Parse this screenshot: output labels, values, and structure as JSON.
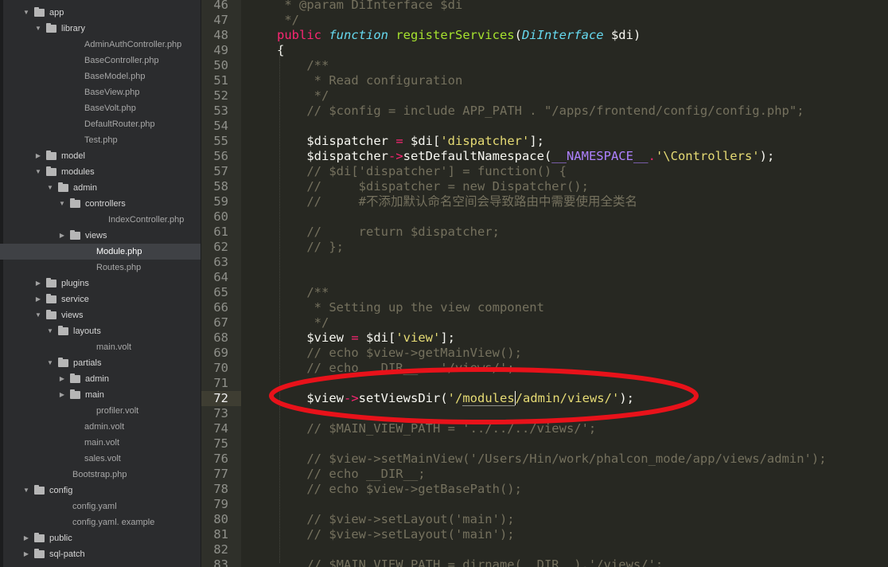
{
  "sidebar": {
    "items": [
      {
        "label": "app",
        "type": "folder",
        "open": true,
        "depth": 1
      },
      {
        "label": "library",
        "type": "folder",
        "open": true,
        "depth": 2
      },
      {
        "label": "AdminAuthController.php",
        "type": "file",
        "depth": 3
      },
      {
        "label": "BaseController.php",
        "type": "file",
        "depth": 3
      },
      {
        "label": "BaseModel.php",
        "type": "file",
        "depth": 3
      },
      {
        "label": "BaseView.php",
        "type": "file",
        "depth": 3
      },
      {
        "label": "BaseVolt.php",
        "type": "file",
        "depth": 3
      },
      {
        "label": "DefaultRouter.php",
        "type": "file",
        "depth": 3
      },
      {
        "label": "Test.php",
        "type": "file",
        "depth": 3
      },
      {
        "label": "model",
        "type": "folder",
        "open": false,
        "depth": 2
      },
      {
        "label": "modules",
        "type": "folder",
        "open": true,
        "depth": 2
      },
      {
        "label": "admin",
        "type": "folder",
        "open": true,
        "depth": 3
      },
      {
        "label": "controllers",
        "type": "folder",
        "open": true,
        "depth": 4
      },
      {
        "label": "IndexController.php",
        "type": "file",
        "depth": 5
      },
      {
        "label": "views",
        "type": "folder",
        "open": false,
        "depth": 4
      },
      {
        "label": "Module.php",
        "type": "file",
        "depth": 4,
        "selected": true
      },
      {
        "label": "Routes.php",
        "type": "file",
        "depth": 4
      },
      {
        "label": "plugins",
        "type": "folder",
        "open": false,
        "depth": 2
      },
      {
        "label": "service",
        "type": "folder",
        "open": false,
        "depth": 2
      },
      {
        "label": "views",
        "type": "folder",
        "open": true,
        "depth": 2
      },
      {
        "label": "layouts",
        "type": "folder",
        "open": true,
        "depth": 3
      },
      {
        "label": "main.volt",
        "type": "file",
        "depth": 4
      },
      {
        "label": "partials",
        "type": "folder",
        "open": true,
        "depth": 3
      },
      {
        "label": "admin",
        "type": "folder",
        "open": false,
        "depth": 4
      },
      {
        "label": "main",
        "type": "folder",
        "open": false,
        "depth": 4
      },
      {
        "label": "profiler.volt",
        "type": "file",
        "depth": 4
      },
      {
        "label": "admin.volt",
        "type": "file",
        "depth": 3
      },
      {
        "label": "main.volt",
        "type": "file",
        "depth": 3
      },
      {
        "label": "sales.volt",
        "type": "file",
        "depth": 3
      },
      {
        "label": "Bootstrap.php",
        "type": "file",
        "depth": 2
      },
      {
        "label": "config",
        "type": "folder",
        "open": true,
        "depth": 1
      },
      {
        "label": "config.yaml",
        "type": "file",
        "depth": 2
      },
      {
        "label": "config.yaml. example",
        "type": "file",
        "depth": 2
      },
      {
        "label": "public",
        "type": "folder",
        "open": false,
        "depth": 1
      },
      {
        "label": "sql-patch",
        "type": "folder",
        "open": false,
        "depth": 1
      }
    ]
  },
  "editor": {
    "active_line": 72,
    "lines": [
      {
        "n": "46",
        "tokens": [
          [
            "cm",
            " * @param DiInterface $di"
          ]
        ]
      },
      {
        "n": "47",
        "tokens": [
          [
            "cm",
            " */"
          ]
        ]
      },
      {
        "n": "48",
        "tokens": [
          [
            "kw",
            "public "
          ],
          [
            "st",
            "function "
          ],
          [
            "fn",
            "registerServices"
          ],
          [
            "plain",
            "("
          ],
          [
            "ty",
            "DiInterface "
          ],
          [
            "plain",
            "$di)"
          ]
        ]
      },
      {
        "n": "49",
        "tokens": [
          [
            "plain",
            "{"
          ]
        ]
      },
      {
        "n": "50",
        "tokens": [
          [
            "cm",
            "    /**"
          ]
        ]
      },
      {
        "n": "51",
        "tokens": [
          [
            "cm",
            "     * Read configuration"
          ]
        ]
      },
      {
        "n": "52",
        "tokens": [
          [
            "cm",
            "     */"
          ]
        ]
      },
      {
        "n": "53",
        "tokens": [
          [
            "cm",
            "    // $config = include APP_PATH . \"/apps/frontend/config/config.php\";"
          ]
        ]
      },
      {
        "n": "54",
        "tokens": []
      },
      {
        "n": "55",
        "tokens": [
          [
            "plain",
            "    $dispatcher "
          ],
          [
            "op",
            "="
          ],
          [
            "plain",
            " $di["
          ],
          [
            "str",
            "'dispatcher'"
          ],
          [
            "plain",
            "];"
          ]
        ]
      },
      {
        "n": "56",
        "tokens": [
          [
            "plain",
            "    $dispatcher"
          ],
          [
            "op",
            "->"
          ],
          [
            "plain",
            "setDefaultNamespace("
          ],
          [
            "con",
            "__NAMESPACE__"
          ],
          [
            "op",
            "."
          ],
          [
            "str",
            "'\\Controllers'"
          ],
          [
            "plain",
            ");"
          ]
        ]
      },
      {
        "n": "57",
        "tokens": [
          [
            "cm",
            "    // $di['dispatcher'] = function() {"
          ]
        ]
      },
      {
        "n": "58",
        "tokens": [
          [
            "cm",
            "    //     $dispatcher = new Dispatcher();"
          ]
        ]
      },
      {
        "n": "59",
        "tokens": [
          [
            "cm",
            "    //     #不添加默认命名空间会导致路由中需要使用全类名"
          ]
        ]
      },
      {
        "n": "60",
        "tokens": []
      },
      {
        "n": "61",
        "tokens": [
          [
            "cm",
            "    //     return $dispatcher;"
          ]
        ]
      },
      {
        "n": "62",
        "tokens": [
          [
            "cm",
            "    // };"
          ]
        ]
      },
      {
        "n": "63",
        "tokens": []
      },
      {
        "n": "64",
        "tokens": []
      },
      {
        "n": "65",
        "tokens": [
          [
            "cm",
            "    /**"
          ]
        ]
      },
      {
        "n": "66",
        "tokens": [
          [
            "cm",
            "     * Setting up the view component"
          ]
        ]
      },
      {
        "n": "67",
        "tokens": [
          [
            "cm",
            "     */"
          ]
        ]
      },
      {
        "n": "68",
        "tokens": [
          [
            "plain",
            "    $view "
          ],
          [
            "op",
            "="
          ],
          [
            "plain",
            " $di["
          ],
          [
            "str",
            "'view'"
          ],
          [
            "plain",
            "];"
          ]
        ]
      },
      {
        "n": "69",
        "tokens": [
          [
            "cm",
            "    // echo $view->getMainView();"
          ]
        ]
      },
      {
        "n": "70",
        "tokens": [
          [
            "cm",
            "    // echo __DIR__ . '/views/';"
          ]
        ]
      },
      {
        "n": "71",
        "tokens": []
      },
      {
        "n": "72",
        "tokens": [
          [
            "plain",
            "    $view"
          ],
          [
            "op",
            "->"
          ],
          [
            "plain",
            "setViewsDir("
          ],
          [
            "str",
            "'/"
          ],
          [
            "strhl",
            "modules"
          ],
          [
            "cursor",
            ""
          ],
          [
            "str",
            "/admin/views/'"
          ],
          [
            "plain",
            ");"
          ]
        ]
      },
      {
        "n": "73",
        "tokens": []
      },
      {
        "n": "74",
        "tokens": [
          [
            "cm",
            "    // $MAIN_VIEW_PATH = '../../../views/';"
          ]
        ]
      },
      {
        "n": "75",
        "tokens": []
      },
      {
        "n": "76",
        "tokens": [
          [
            "cm",
            "    // $view->setMainView('/Users/Hin/work/phalcon_mode/app/views/admin');"
          ]
        ]
      },
      {
        "n": "77",
        "tokens": [
          [
            "cm",
            "    // echo __DIR__;"
          ]
        ]
      },
      {
        "n": "78",
        "tokens": [
          [
            "cm",
            "    // echo $view->getBasePath();"
          ]
        ]
      },
      {
        "n": "79",
        "tokens": []
      },
      {
        "n": "80",
        "tokens": [
          [
            "cm",
            "    // $view->setLayout('main');"
          ]
        ]
      },
      {
        "n": "81",
        "tokens": [
          [
            "cm",
            "    // $view->setLayout('main');"
          ]
        ]
      },
      {
        "n": "82",
        "tokens": []
      },
      {
        "n": "83",
        "tokens": [
          [
            "cm",
            "    // $MAIN_VIEW_PATH = dirname(__DIR__).'/views/';"
          ]
        ]
      }
    ]
  },
  "colors": {
    "annotation": "#e8121a",
    "keyword": "#f92672",
    "function": "#a6e22e",
    "string": "#e6db74",
    "comment": "#75715e",
    "storage": "#66d9ef",
    "constant": "#ae81ff"
  }
}
